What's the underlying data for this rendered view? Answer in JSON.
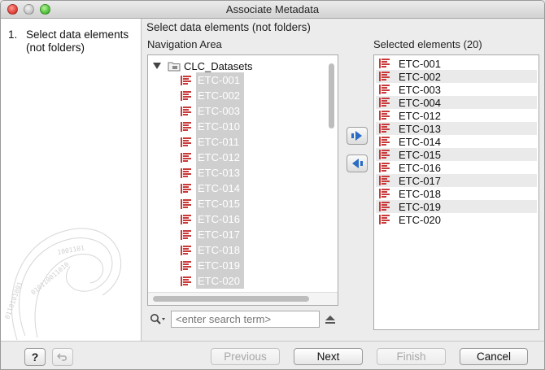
{
  "window": {
    "title": "Associate Metadata"
  },
  "steps": [
    {
      "num": "1.",
      "label": "Select data elements (not folders)"
    }
  ],
  "instruction": "Select data elements (not folders)",
  "navigation": {
    "label": "Navigation Area",
    "root": "CLC_Datasets",
    "items": [
      "ETC-001",
      "ETC-002",
      "ETC-003",
      "ETC-010",
      "ETC-011",
      "ETC-012",
      "ETC-013",
      "ETC-014",
      "ETC-015",
      "ETC-016",
      "ETC-017",
      "ETC-018",
      "ETC-019",
      "ETC-020"
    ]
  },
  "selected": {
    "label": "Selected elements (20)",
    "items": [
      "ETC-001",
      "ETC-002",
      "ETC-003",
      "ETC-004",
      "ETC-012",
      "ETC-013",
      "ETC-014",
      "ETC-015",
      "ETC-016",
      "ETC-017",
      "ETC-018",
      "ETC-019",
      "ETC-020"
    ]
  },
  "search": {
    "placeholder": "<enter search term>"
  },
  "buttons": {
    "help": "?",
    "previous": "Previous",
    "next": "Next",
    "finish": "Finish",
    "cancel": "Cancel"
  },
  "colors": {
    "sequence_icon": "#c8393a",
    "arrow_icon": "#2a6cc4"
  }
}
